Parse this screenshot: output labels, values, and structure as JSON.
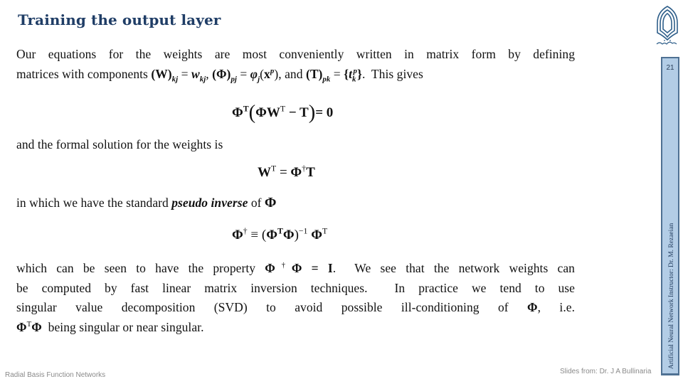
{
  "slide": {
    "title": "Training the output layer",
    "page_number": "21",
    "side_label": "Artificial Neural Network Instructor: Dr. M. Rezaeian",
    "logo_icon": "university-logo-icon",
    "accent_color": "#1f3d66",
    "sidebar_color": "#b3cde6"
  },
  "body": {
    "p1_line1": "Our equations for the weights are most conveniently written in matrix form by defining",
    "p1_line2_text1": "matrices with components ",
    "p1_def_W": "(W)",
    "p1_def_W_sub": "kj",
    "p1_eq": " = ",
    "p1_w": "w",
    "p1_w_sub": "kj",
    "p1_sep1": ", ",
    "p1_def_Phi": "(Φ)",
    "p1_def_Phi_sub": "pj",
    "p1_phi": "φ",
    "p1_phi_sub": "j",
    "p1_phi_arg_open": "(",
    "p1_x": "x",
    "p1_x_sup": "p",
    "p1_phi_arg_close": ")",
    "p1_sep2": ", and ",
    "p1_def_T": "(T)",
    "p1_def_T_sub": "pk",
    "p1_t_open": "{",
    "p1_t": "t",
    "p1_t_sub": "k",
    "p1_t_sup": "p",
    "p1_t_close": "}",
    "p1_end": ".  This gives",
    "p2": "and the formal solution for the weights is",
    "p3_text": "in which we have the standard ",
    "p3_em": "pseudo inverse",
    "p3_of": " of ",
    "p3_phi": "Φ",
    "p4_line1_a": "which can be seen to have the property ",
    "p4_prop_phi": "Φ",
    "p4_prop_dag": "†",
    "p4_prop_rest": "Φ = I",
    "p4_line1_b": ".  We see that the network weights can",
    "p4_line2": "be computed by fast linear matrix inversion techniques.  In practice we tend to use",
    "p4_line3_a": "singular value decomposition (SVD) to avoid possible ill-conditioning of ",
    "p4_line3_phi": "Φ",
    "p4_line3_b": ", i.e.",
    "p4_line4_phi1": "Φ",
    "p4_line4_sup": "T",
    "p4_line4_phi2": "Φ",
    "p4_line4_text": "  being singular or near singular."
  },
  "equations": {
    "eq1": {
      "phi": "Φ",
      "sup_t": "T",
      "open": "(",
      "inner": "ΦW",
      "inner_sup": "T",
      "minus": " − T",
      "close": ")",
      "rhs": "= 0"
    },
    "eq2": {
      "lhs": "W",
      "lhs_sup": "T",
      "eq": " = ",
      "phi": "Φ",
      "dag": "†",
      "t": "T"
    },
    "eq3": {
      "lhs": "Φ",
      "lhs_sup": "†",
      "equiv": " ≡ (",
      "phi1": "Φ",
      "sup1": "T",
      "phi2": "Φ",
      "close": ")",
      "inv": "−1",
      "phi3": " Φ",
      "sup3": "T"
    }
  },
  "footer": {
    "left": "Radial Basis Function Networks",
    "right": "Slides from: Dr. J A Bullinaria"
  }
}
